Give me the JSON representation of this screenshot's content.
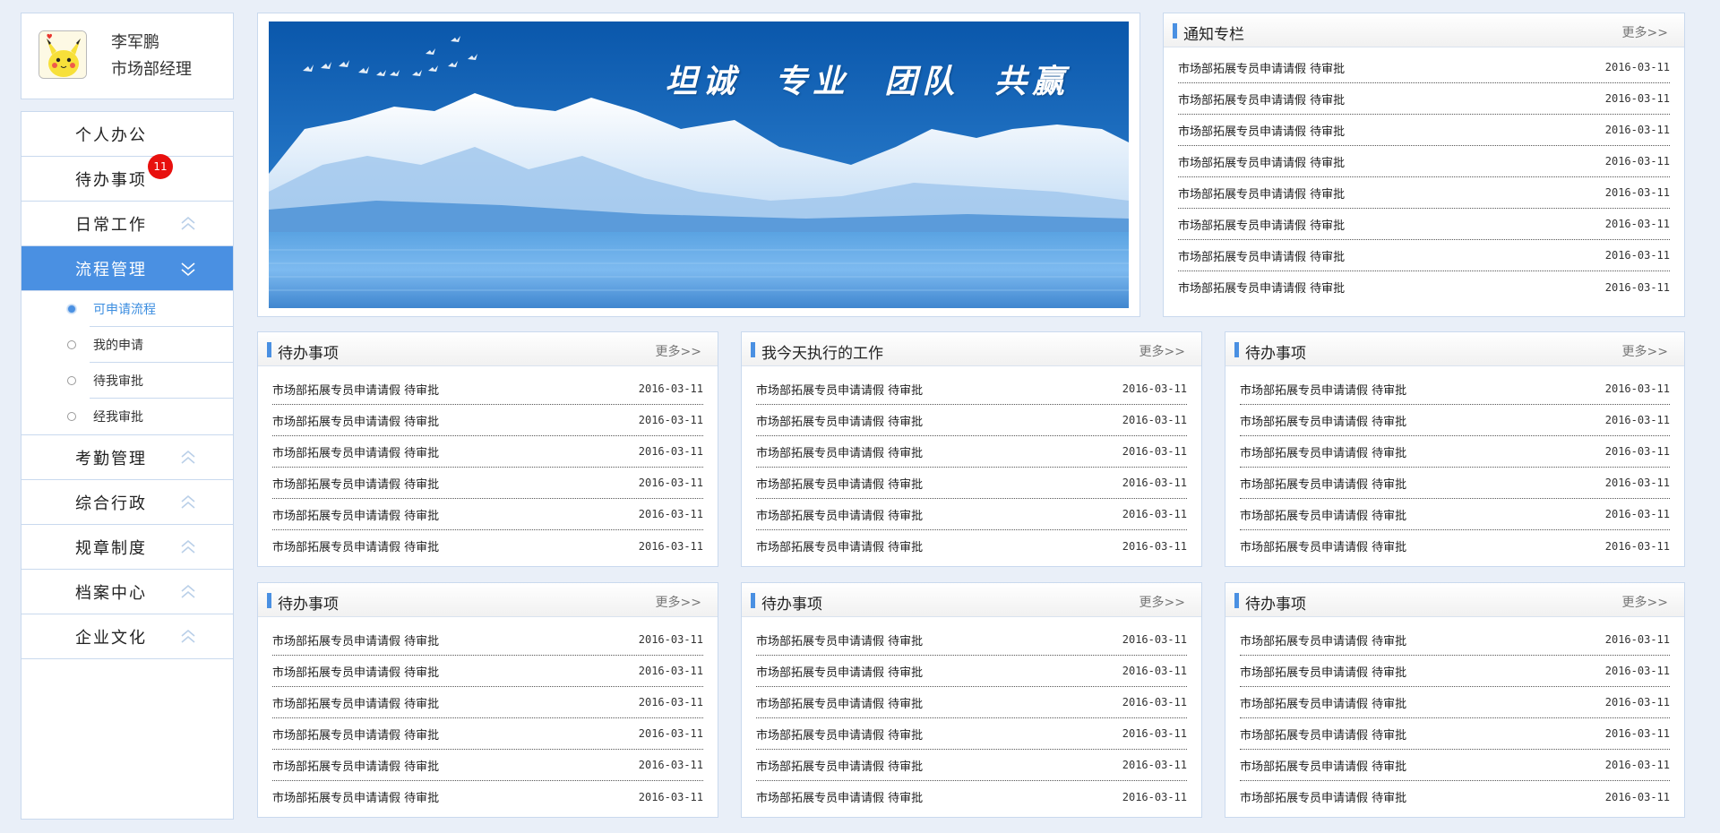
{
  "user": {
    "name": "李军鹏",
    "role": "市场部经理"
  },
  "nav": {
    "items": [
      {
        "label": "个人办公",
        "chevron": "none"
      },
      {
        "label": "待办事项",
        "chevron": "none",
        "badge": "11"
      },
      {
        "label": "日常工作",
        "chevron": "up"
      },
      {
        "label": "流程管理",
        "chevron": "down",
        "active": true
      }
    ],
    "sub_items": [
      {
        "label": "可申请流程",
        "active": true
      },
      {
        "label": "我的申请"
      },
      {
        "label": "待我审批"
      },
      {
        "label": "经我审批"
      }
    ],
    "items_after": [
      {
        "label": "考勤管理",
        "chevron": "up"
      },
      {
        "label": "综合行政",
        "chevron": "up"
      },
      {
        "label": "规章制度",
        "chevron": "up"
      },
      {
        "label": "档案中心",
        "chevron": "up"
      },
      {
        "label": "企业文化",
        "chevron": "up"
      }
    ]
  },
  "banner": {
    "slogan": "坦诚 专业 团队 共赢"
  },
  "colors": {
    "accent": "#4a90e2",
    "badge": "#e8100e",
    "background": "#e9eff8"
  },
  "panels": {
    "notice": {
      "title": "通知专栏",
      "more": "更多>>",
      "rows": [
        {
          "text": "市场部拓展专员申请请假 待审批",
          "date": "2016-03-11"
        },
        {
          "text": "市场部拓展专员申请请假 待审批",
          "date": "2016-03-11"
        },
        {
          "text": "市场部拓展专员申请请假 待审批",
          "date": "2016-03-11"
        },
        {
          "text": "市场部拓展专员申请请假 待审批",
          "date": "2016-03-11"
        },
        {
          "text": "市场部拓展专员申请请假 待审批",
          "date": "2016-03-11"
        },
        {
          "text": "市场部拓展专员申请请假 待审批",
          "date": "2016-03-11"
        },
        {
          "text": "市场部拓展专员申请请假 待审批",
          "date": "2016-03-11"
        },
        {
          "text": "市场部拓展专员申请请假 待审批",
          "date": "2016-03-11"
        }
      ]
    },
    "grid": [
      {
        "title": "待办事项",
        "more": "更多>>",
        "rows": [
          {
            "text": "市场部拓展专员申请请假 待审批",
            "date": "2016-03-11"
          },
          {
            "text": "市场部拓展专员申请请假 待审批",
            "date": "2016-03-11"
          },
          {
            "text": "市场部拓展专员申请请假 待审批",
            "date": "2016-03-11"
          },
          {
            "text": "市场部拓展专员申请请假 待审批",
            "date": "2016-03-11"
          },
          {
            "text": "市场部拓展专员申请请假 待审批",
            "date": "2016-03-11"
          },
          {
            "text": "市场部拓展专员申请请假 待审批",
            "date": "2016-03-11"
          }
        ]
      },
      {
        "title": "我今天执行的工作",
        "more": "更多>>",
        "rows": [
          {
            "text": "市场部拓展专员申请请假 待审批",
            "date": "2016-03-11"
          },
          {
            "text": "市场部拓展专员申请请假 待审批",
            "date": "2016-03-11"
          },
          {
            "text": "市场部拓展专员申请请假 待审批",
            "date": "2016-03-11"
          },
          {
            "text": "市场部拓展专员申请请假 待审批",
            "date": "2016-03-11"
          },
          {
            "text": "市场部拓展专员申请请假 待审批",
            "date": "2016-03-11"
          },
          {
            "text": "市场部拓展专员申请请假 待审批",
            "date": "2016-03-11"
          }
        ]
      },
      {
        "title": "待办事项",
        "more": "更多>>",
        "rows": [
          {
            "text": "市场部拓展专员申请请假 待审批",
            "date": "2016-03-11"
          },
          {
            "text": "市场部拓展专员申请请假 待审批",
            "date": "2016-03-11"
          },
          {
            "text": "市场部拓展专员申请请假 待审批",
            "date": "2016-03-11"
          },
          {
            "text": "市场部拓展专员申请请假 待审批",
            "date": "2016-03-11"
          },
          {
            "text": "市场部拓展专员申请请假 待审批",
            "date": "2016-03-11"
          },
          {
            "text": "市场部拓展专员申请请假 待审批",
            "date": "2016-03-11"
          }
        ]
      },
      {
        "title": "待办事项",
        "more": "更多>>",
        "rows": [
          {
            "text": "市场部拓展专员申请请假 待审批",
            "date": "2016-03-11"
          },
          {
            "text": "市场部拓展专员申请请假 待审批",
            "date": "2016-03-11"
          },
          {
            "text": "市场部拓展专员申请请假 待审批",
            "date": "2016-03-11"
          },
          {
            "text": "市场部拓展专员申请请假 待审批",
            "date": "2016-03-11"
          },
          {
            "text": "市场部拓展专员申请请假 待审批",
            "date": "2016-03-11"
          },
          {
            "text": "市场部拓展专员申请请假 待审批",
            "date": "2016-03-11"
          }
        ]
      },
      {
        "title": "待办事项",
        "more": "更多>>",
        "rows": [
          {
            "text": "市场部拓展专员申请请假 待审批",
            "date": "2016-03-11"
          },
          {
            "text": "市场部拓展专员申请请假 待审批",
            "date": "2016-03-11"
          },
          {
            "text": "市场部拓展专员申请请假 待审批",
            "date": "2016-03-11"
          },
          {
            "text": "市场部拓展专员申请请假 待审批",
            "date": "2016-03-11"
          },
          {
            "text": "市场部拓展专员申请请假 待审批",
            "date": "2016-03-11"
          },
          {
            "text": "市场部拓展专员申请请假 待审批",
            "date": "2016-03-11"
          }
        ]
      },
      {
        "title": "待办事项",
        "more": "更多>>",
        "rows": [
          {
            "text": "市场部拓展专员申请请假 待审批",
            "date": "2016-03-11"
          },
          {
            "text": "市场部拓展专员申请请假 待审批",
            "date": "2016-03-11"
          },
          {
            "text": "市场部拓展专员申请请假 待审批",
            "date": "2016-03-11"
          },
          {
            "text": "市场部拓展专员申请请假 待审批",
            "date": "2016-03-11"
          },
          {
            "text": "市场部拓展专员申请请假 待审批",
            "date": "2016-03-11"
          },
          {
            "text": "市场部拓展专员申请请假 待审批",
            "date": "2016-03-11"
          }
        ]
      }
    ]
  }
}
